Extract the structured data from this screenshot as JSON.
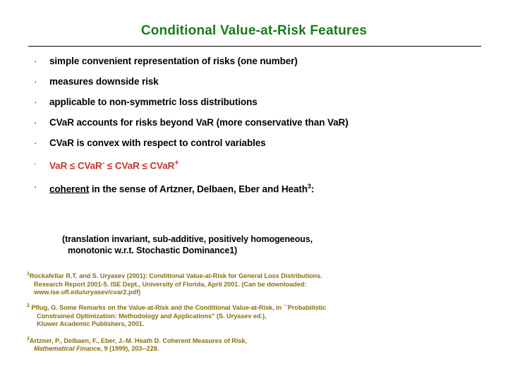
{
  "slide": {
    "title": "Conditional Value-at-Risk Features",
    "bullet_marker": "·",
    "bullets": [
      {
        "text": "simple convenient representation of risks (one number)",
        "color": "#000000"
      },
      {
        "text": "measures downside risk",
        "color": "#000000"
      },
      {
        "text": "applicable to non-symmetric loss distributions",
        "color": "#000000"
      },
      {
        "text": "CVaR accounts for risks beyond VaR (more conservative than VaR)",
        "color": "#000000"
      },
      {
        "text": "CVaR is convex with respect to control variables",
        "color": "#000000"
      }
    ],
    "formula_bullet": {
      "color": "#c0392b",
      "part1": "VaR ≤ CVaR",
      "sup1": "-",
      "part2": " ≤ CVaR ≤ CVaR",
      "sup2": "+"
    },
    "coherent_bullet": {
      "underlined": "coherent",
      "rest": " in the sense of Artzner, Delbaen, Eber and Heath",
      "superscript": "3",
      "tail": ":"
    },
    "parenthetical": {
      "line1": "(translation invariant, sub-additive, positively homogeneous,",
      "line2": "monotonic w.r.t. Stochastic Dominance1)"
    },
    "references": [
      {
        "marker": "1",
        "lines": [
          "Rockafellar R.T. and S. Uryasev (2001): Conditional Value-at-Risk for General Loss Distributions.",
          "Research Report 2001-5. ISE Dept., University of Florida, April 2001. (Can be downloaded:",
          "www.ise.ufl.edu/uryasev/cvar2.pdf)"
        ]
      },
      {
        "marker": "2",
        "lines": [
          " Pflug, G. Some Remarks on the Value-at-Risk and the Conditional Value-at-Risk, in ``Probabilistic",
          "Constrained Optimization: Methodology and Applications\" (S. Uryasev ed.),",
          "Kluwer Academic Publishers, 2001."
        ]
      },
      {
        "marker": "3",
        "lines": [
          "Artzner, P., Delbaen, F., Eber, J.-M. Heath D. Coherent Measures of Risk,"
        ],
        "italic_line": "Mathematical Finance",
        "italic_tail": ", 9 (1999), 203--228."
      }
    ],
    "colors": {
      "title": "#1a7a1a",
      "body": "#000000",
      "accent": "#c0392b",
      "footnote": "#8a7014",
      "background": "#ffffff"
    }
  }
}
